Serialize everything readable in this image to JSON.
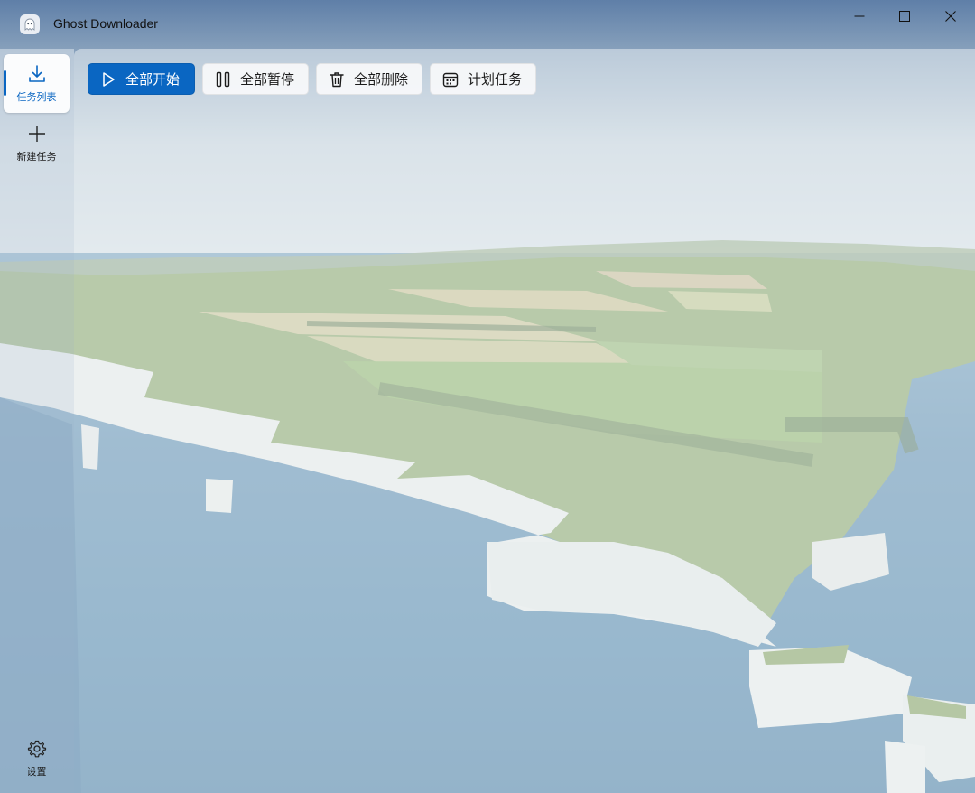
{
  "window": {
    "title": "Ghost Downloader",
    "app_icon": "ghost-icon",
    "controls": [
      "minimize-icon",
      "maximize-icon",
      "close-icon"
    ]
  },
  "sidebar": {
    "items": [
      {
        "label": "任务列表",
        "icon": "download-icon",
        "active": true
      },
      {
        "label": "新建任务",
        "icon": "plus-icon",
        "active": false
      }
    ],
    "footer": {
      "label": "设置",
      "icon": "gear-icon"
    }
  },
  "toolbar": {
    "start_all": {
      "label": "全部开始",
      "icon": "play-icon"
    },
    "pause_all": {
      "label": "全部暂停",
      "icon": "pause-icon"
    },
    "delete_all": {
      "label": "全部删除",
      "icon": "trash-icon"
    },
    "schedule": {
      "label": "计划任务",
      "icon": "calendar-icon"
    }
  },
  "colors": {
    "accent": "#0a66c2",
    "sidebar_overlay": "#d6e0ea",
    "content_overlay": "#ecf1f6"
  }
}
